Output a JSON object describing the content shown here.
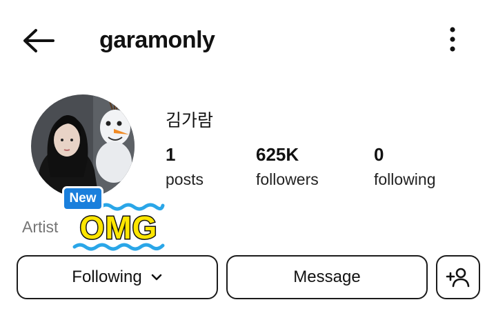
{
  "header": {
    "username": "garamonly",
    "back_icon": "arrow-left-icon",
    "more_icon": "more-vertical-icon"
  },
  "profile": {
    "display_name": "김가람",
    "category": "Artist",
    "avatar": "profile-photo"
  },
  "stats": {
    "posts": {
      "value": "1",
      "label": "posts"
    },
    "followers": {
      "value": "625K",
      "label": "followers"
    },
    "following": {
      "value": "0",
      "label": "following"
    }
  },
  "sticker": {
    "badge_text": "New",
    "omg_text": "OMG",
    "badge_color": "#1a7fdc",
    "omg_color": "#ffe600",
    "wave_color": "#2aa6e8"
  },
  "actions": {
    "following_label": "Following",
    "message_label": "Message",
    "add_user_icon": "add-person-icon"
  }
}
